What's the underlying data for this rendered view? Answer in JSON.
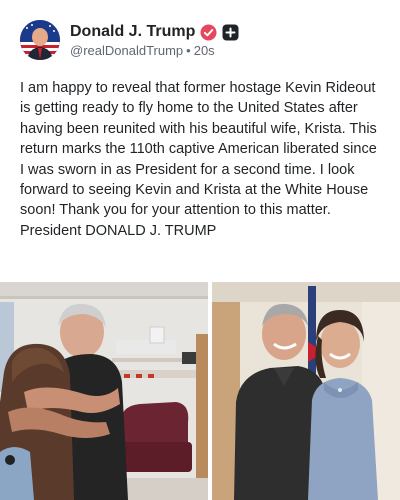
{
  "author": {
    "display_name": "Donald J. Trump",
    "handle": "@realDonaldTrump",
    "separator": "•",
    "time_ago": "20s",
    "avatar_icon": "avatar-flag-portrait",
    "verified_icon": "verified-badge-icon",
    "verified_color": "#e5485e",
    "follow_icon": "plus-icon"
  },
  "post": {
    "text": "I am happy to reveal that former hostage Kevin Rideout is getting ready to fly home to the United States after having been reunited with his beautiful wife, Krista. This return marks the 110th captive American liberated since I was sworn in as President for a second time. I look forward to seeing Kevin and Krista at the White House soon! Thank you for your attention to this matter. President DONALD J. TRUMP"
  },
  "media": {
    "count": 2
  }
}
